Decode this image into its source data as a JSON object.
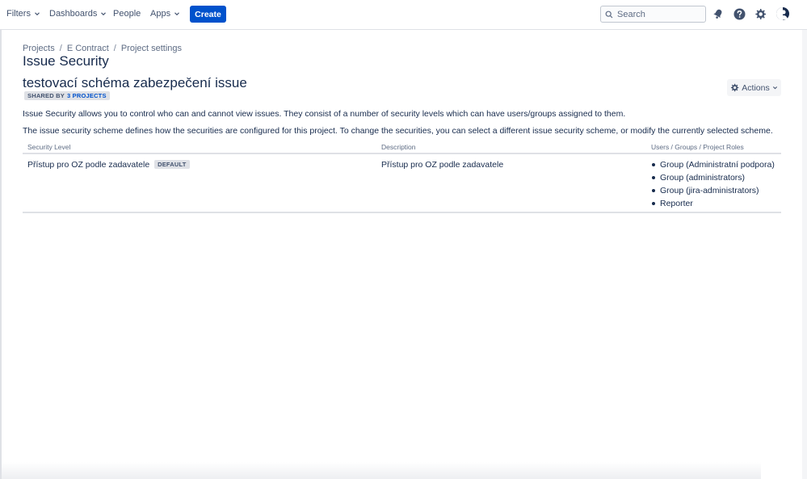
{
  "nav": {
    "filters": "Filters",
    "dashboards": "Dashboards",
    "people": "People",
    "apps": "Apps",
    "create": "Create",
    "search_placeholder": "Search"
  },
  "breadcrumb": [
    "Projects",
    "E Contract",
    "Project settings"
  ],
  "page_title": "Issue Security",
  "scheme": {
    "name": "testovací schéma zabezpečení issue",
    "shared_prefix": "SHARED BY",
    "shared_link": "3 PROJECTS"
  },
  "actions_label": "Actions",
  "descriptions": [
    "Issue Security allows you to control who can and cannot view issues. They consist of a number of security levels which can have users/groups assigned to them.",
    "The issue security scheme defines how the securities are configured for this project. To change the securities, you can select a different issue security scheme, or modify the currently selected scheme."
  ],
  "table": {
    "headers": [
      "Security Level",
      "Description",
      "Users / Groups / Project Roles"
    ],
    "rows": [
      {
        "level": "Přístup pro OZ podle zadavatele",
        "badge": "DEFAULT",
        "description": "Přístup pro OZ podle zadavatele",
        "members": [
          "Group (Administratní podpora)",
          "Group (administrators)",
          "Group (jira-administrators)",
          "Reporter"
        ]
      }
    ]
  },
  "colors": {
    "primary": "#0052cc",
    "text": "#172b4d",
    "muted": "#5e6c84",
    "border": "#dfe1e6"
  }
}
